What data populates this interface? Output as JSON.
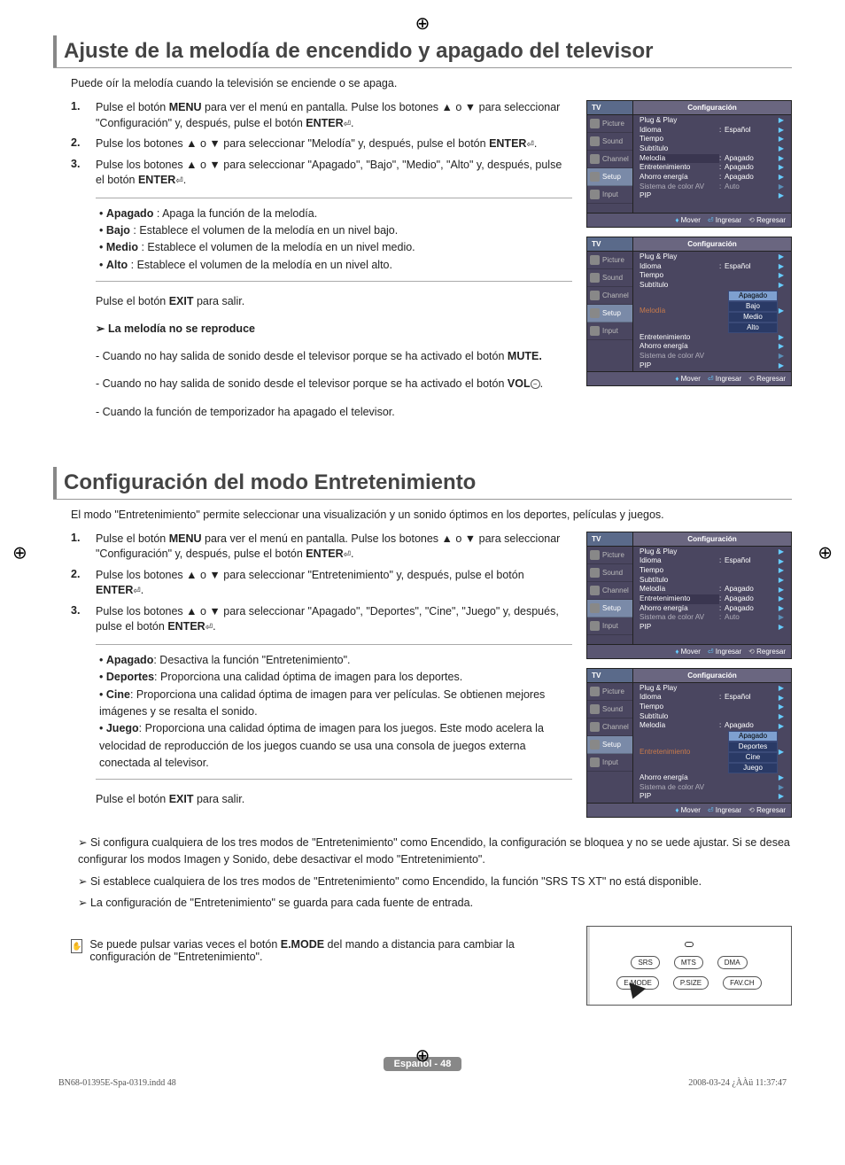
{
  "reg_mark": "⊕",
  "section1": {
    "heading": "Ajuste de la melodía de encendido y apagado del televisor",
    "intro": "Puede oír la melodía cuando la televisión se enciende o se apaga.",
    "steps": [
      {
        "num": "1.",
        "text_pre": "Pulse el botón ",
        "b1": "MENU",
        "text_mid1": " para ver el menú en pantalla.\nPulse los botones ▲ o ▼ para seleccionar \"Configuración\" y, después, pulse el botón ",
        "b2": "ENTER",
        "text_end": "."
      },
      {
        "num": "2.",
        "text_pre": "Pulse los botones ▲ o ▼ para seleccionar \"Melodía\" y, después, pulse el botón ",
        "b1": "ENTER",
        "text_end": "."
      },
      {
        "num": "3.",
        "text_pre": "Pulse los botones ▲ o ▼ para seleccionar \"Apagado\", \"Bajo\", \"Medio\", \"Alto\" y, después, pulse el botón ",
        "b1": "ENTER",
        "text_end": "."
      }
    ],
    "bullets": [
      {
        "b": "Apagado",
        "t": " : Apaga la función de la melodía."
      },
      {
        "b": "Bajo",
        "t": " : Establece el volumen de la melodía en un nivel bajo."
      },
      {
        "b": "Medio",
        "t": " : Establece el volumen de la melodía en un nivel medio."
      },
      {
        "b": "Alto",
        "t": " : Establece el volumen de la melodía en un nivel alto."
      }
    ],
    "exit_pre": "Pulse el botón ",
    "exit_b": "EXIT",
    "exit_post": " para salir.",
    "no_play_title": "La melodía no se reproduce",
    "no_play": [
      {
        "pre": "Cuando no hay salida de sonido desde el televisor porque se ha activado el botón ",
        "b": "MUTE."
      },
      {
        "pre": "Cuando no hay salida de sonido desde el televisor porque se ha activado el botón ",
        "b": "VOL",
        "icon": "−"
      },
      {
        "pre": "Cuando la función de temporizador ha apagado el televisor."
      }
    ]
  },
  "section2": {
    "heading": "Configuración del modo Entretenimiento",
    "intro": "El modo \"Entretenimiento\" permite seleccionar una visualización y un sonido óptimos en los deportes, películas y juegos.",
    "steps": [
      {
        "num": "1.",
        "text_pre": "Pulse el botón ",
        "b1": "MENU",
        "text_mid1": " para ver el menú en pantalla.\nPulse los botones ▲ o ▼ para seleccionar \"Configuración\" y, después, pulse el botón ",
        "b2": "ENTER",
        "text_end": "."
      },
      {
        "num": "2.",
        "text_pre": "Pulse los botones ▲ o ▼ para seleccionar \"Entretenimiento\" y, después, pulse el botón ",
        "b1": "ENTER",
        "text_end": "."
      },
      {
        "num": "3.",
        "text_pre": "Pulse los botones ▲ o ▼ para seleccionar \"Apagado\", \"Deportes\", \"Cine\", \"Juego\" y, después, pulse el botón ",
        "b1": "ENTER",
        "text_end": "."
      }
    ],
    "bullets": [
      {
        "b": "Apagado",
        "t": ": Desactiva la función \"Entretenimiento\"."
      },
      {
        "b": "Deportes",
        "t": ": Proporciona una calidad óptima de imagen para los deportes."
      },
      {
        "b": "Cine",
        "t": ": Proporciona una calidad óptima de imagen para ver películas. Se obtienen mejores imágenes y se resalta el sonido."
      },
      {
        "b": "Juego",
        "t": ": Proporciona una calidad óptima de imagen para los juegos. Este modo acelera la velocidad de reproducción de los juegos cuando se usa una consola de juegos externa conectada al televisor."
      }
    ],
    "exit_pre": "Pulse el botón ",
    "exit_b": "EXIT",
    "exit_post": " para salir.",
    "arrows": [
      "Si configura cualquiera de los tres modos de \"Entretenimiento\" como Encendido, la configuración se bloquea y no se uede ajustar. Si se desea configurar los modos Imagen y Sonido, debe desactivar el modo \"Entretenimiento\".",
      "Si establece cualquiera de los tres modos de \"Entretenimiento\" como Encendido, la función \"SRS TS XT\" no está disponible.",
      "La configuración de \"Entretenimiento\" se guarda para cada fuente de entrada."
    ],
    "remote_note_pre": "Se puede pulsar varias veces el botón ",
    "remote_note_b": "E.MODE",
    "remote_note_post": " del mando a distancia para cambiar la configuración de \"Entretenimiento\"."
  },
  "osd": {
    "tv": "TV",
    "title": "Configuración",
    "tabs": [
      "Picture",
      "Sound",
      "Channel",
      "Setup",
      "Input"
    ],
    "footer": {
      "mover": "Mover",
      "ingresar": "Ingresar",
      "regresar": "Regresar"
    },
    "panel1_rows": [
      {
        "lbl": "Plug & Play",
        "val": ""
      },
      {
        "lbl": "Idioma",
        "val": "Español"
      },
      {
        "lbl": "Tiempo",
        "val": ""
      },
      {
        "lbl": "Subtítulo",
        "val": ""
      },
      {
        "lbl": "Melodía",
        "val": "Apagado",
        "hl": true
      },
      {
        "lbl": "Entretenimiento",
        "val": "Apagado"
      },
      {
        "lbl": "Ahorro energía",
        "val": "Apagado"
      },
      {
        "lbl": "Sistema de color AV",
        "val": "Auto",
        "dim": true
      },
      {
        "lbl": "PIP",
        "val": ""
      }
    ],
    "panel2_rows": [
      {
        "lbl": "Plug & Play",
        "val": ""
      },
      {
        "lbl": "Idioma",
        "val": "Español"
      },
      {
        "lbl": "Tiempo",
        "val": ""
      },
      {
        "lbl": "Subtítulo",
        "val": ""
      },
      {
        "lbl": "Melodía",
        "val": "",
        "orange": true
      },
      {
        "lbl": "Entretenimiento",
        "val": ""
      },
      {
        "lbl": "Ahorro energía",
        "val": ""
      },
      {
        "lbl": "Sistema de color AV",
        "val": "",
        "dim": true
      },
      {
        "lbl": "PIP",
        "val": ""
      }
    ],
    "panel2_opts": [
      "Apagado",
      "Bajo",
      "Medio",
      "Alto"
    ],
    "panel3_rows": [
      {
        "lbl": "Plug & Play",
        "val": ""
      },
      {
        "lbl": "Idioma",
        "val": "Español"
      },
      {
        "lbl": "Tiempo",
        "val": ""
      },
      {
        "lbl": "Subtítulo",
        "val": ""
      },
      {
        "lbl": "Melodía",
        "val": "Apagado"
      },
      {
        "lbl": "Entretenimiento",
        "val": "Apagado",
        "hl": true
      },
      {
        "lbl": "Ahorro energía",
        "val": "Apagado"
      },
      {
        "lbl": "Sistema de color AV",
        "val": "Auto",
        "dim": true
      },
      {
        "lbl": "PIP",
        "val": ""
      }
    ],
    "panel4_rows": [
      {
        "lbl": "Plug & Play",
        "val": ""
      },
      {
        "lbl": "Idioma",
        "val": "Español"
      },
      {
        "lbl": "Tiempo",
        "val": ""
      },
      {
        "lbl": "Subtítulo",
        "val": ""
      },
      {
        "lbl": "Melodía",
        "val": "Apagado"
      },
      {
        "lbl": "Entretenimiento",
        "val": "",
        "orange": true
      },
      {
        "lbl": "Ahorro energía",
        "val": ""
      },
      {
        "lbl": "Sistema de color AV",
        "val": "",
        "dim": true
      },
      {
        "lbl": "PIP",
        "val": ""
      }
    ],
    "panel4_opts": [
      "Apagado",
      "Deportes",
      "Cine",
      "Juego"
    ]
  },
  "remote_buttons_row1": [
    "SRS",
    "MTS",
    "DMA"
  ],
  "remote_buttons_row2": [
    "E.MODE",
    "P.SIZE",
    "FAV.CH"
  ],
  "page_num": "Español - 48",
  "footer_left": "BN68-01395E-Spa-0319.indd   48",
  "footer_right": "2008-03-24   ¿ÀÀü 11:37:47"
}
